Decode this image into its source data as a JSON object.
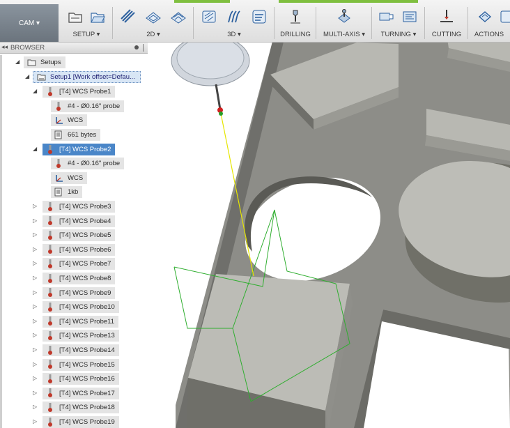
{
  "workspace": {
    "label": "CAM ▾"
  },
  "ribbon": [
    {
      "label": "SETUP ▾",
      "icons": [
        "new-setup-icon",
        "open-folder-icon"
      ]
    },
    {
      "label": "2D ▾",
      "icons": [
        "2d-pocket-icon",
        "2d-contour-icon",
        "2d-adaptive-icon"
      ]
    },
    {
      "label": "3D ▾",
      "icons": [
        "3d-adaptive-icon",
        "3d-parallel-icon",
        "3d-contour-icon"
      ]
    },
    {
      "label": "DRILLING",
      "icons": [
        "drill-icon"
      ]
    },
    {
      "label": "MULTI-AXIS ▾",
      "icons": [
        "multi-axis-icon"
      ]
    },
    {
      "label": "TURNING ▾",
      "icons": [
        "turning-face-icon",
        "turning-profile-icon"
      ]
    },
    {
      "label": "CUTTING",
      "icons": [
        "cutting-icon"
      ]
    },
    {
      "label": "ACTIONS",
      "icons": [
        "actions-icon"
      ]
    }
  ],
  "browser": {
    "title": "BROWSER",
    "root": "Setups",
    "setup": "Setup1 [Work offset=Defau...",
    "probe1": {
      "label": "[T4] WCS Probe1",
      "children": [
        "#4 - Ø0.16\" probe",
        "WCS",
        "661 bytes"
      ]
    },
    "probe2": {
      "label": "[T4] WCS Probe2",
      "children": [
        "#4 - Ø0.16\" probe",
        "WCS",
        "1kb"
      ]
    },
    "collapsed": [
      "[T4] WCS Probe3",
      "[T4] WCS Probe4",
      "[T4] WCS Probe5",
      "[T4] WCS Probe6",
      "[T4] WCS Probe7",
      "[T4] WCS Probe8",
      "[T4] WCS Probe9",
      "[T4] WCS Probe10",
      "[T4] WCS Probe11",
      "[T4] WCS Probe13",
      "[T4] WCS Probe14",
      "[T4] WCS Probe15",
      "[T4] WCS Probe16",
      "[T4] WCS Probe17",
      "[T4] WCS Probe18",
      "[T4] WCS Probe19"
    ]
  },
  "colors": {
    "selection": "#4a86c8",
    "probe_icon": "#c0392b",
    "toolpath_green": "#2fae2f",
    "probe_path_yellow": "#e6e600",
    "part_gray": "#8d8d88"
  }
}
